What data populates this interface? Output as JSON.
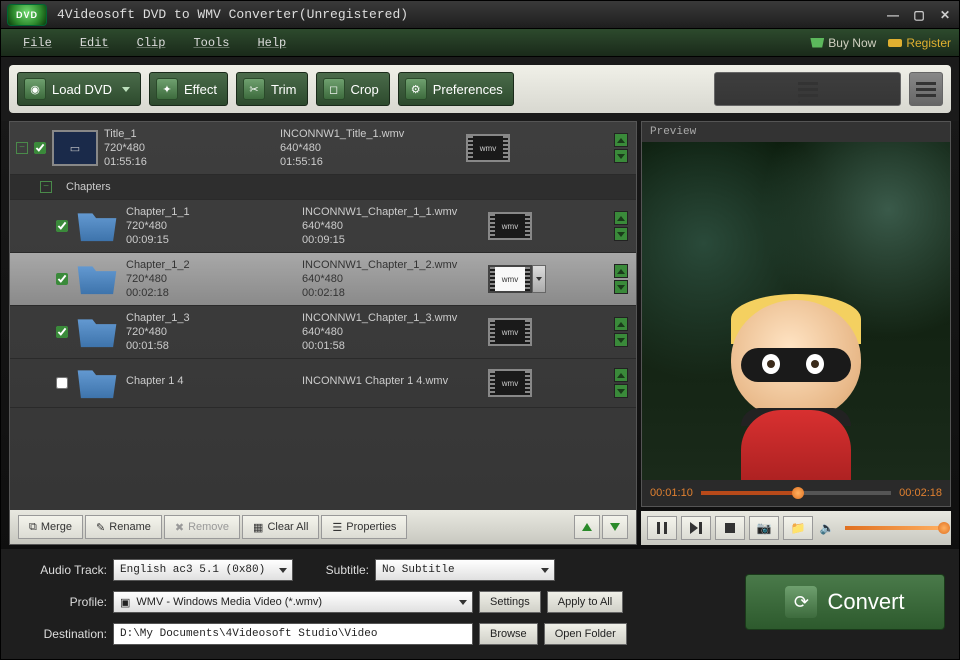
{
  "title": "4Videosoft DVD to WMV Converter(Unregistered)",
  "logo_text": "DVD",
  "menubar": {
    "file": "File",
    "edit": "Edit",
    "clip": "Clip",
    "tools": "Tools",
    "help": "Help",
    "buy": "Buy Now",
    "register": "Register"
  },
  "toolbar": {
    "load": "Load DVD",
    "effect": "Effect",
    "trim": "Trim",
    "crop": "Crop",
    "prefs": "Preferences"
  },
  "group_label": "Chapters",
  "items": [
    {
      "checked": true,
      "expandable": true,
      "kind": "title",
      "name": "Title_1",
      "res": "720*480",
      "dur": "01:55:16",
      "out": "INCONNW1_Title_1.wmv",
      "ores": "640*480",
      "odur": "01:55:16",
      "fmt": "wmv"
    },
    {
      "checked": true,
      "kind": "chapter",
      "name": "Chapter_1_1",
      "res": "720*480",
      "dur": "00:09:15",
      "out": "INCONNW1_Chapter_1_1.wmv",
      "ores": "640*480",
      "odur": "00:09:15",
      "fmt": "wmv"
    },
    {
      "checked": true,
      "kind": "chapter",
      "selected": true,
      "name": "Chapter_1_2",
      "res": "720*480",
      "dur": "00:02:18",
      "out": "INCONNW1_Chapter_1_2.wmv",
      "ores": "640*480",
      "odur": "00:02:18",
      "fmt": "wmv"
    },
    {
      "checked": true,
      "kind": "chapter",
      "name": "Chapter_1_3",
      "res": "720*480",
      "dur": "00:01:58",
      "out": "INCONNW1_Chapter_1_3.wmv",
      "ores": "640*480",
      "odur": "00:01:58",
      "fmt": "wmv"
    },
    {
      "checked": false,
      "kind": "chapter",
      "partial": true,
      "name": "Chapter 1 4",
      "res": "",
      "dur": "",
      "out": "INCONNW1 Chapter 1 4.wmv",
      "ores": "",
      "odur": "",
      "fmt": "wmv"
    }
  ],
  "ops": {
    "merge": "Merge",
    "rename": "Rename",
    "remove": "Remove",
    "clear": "Clear All",
    "props": "Properties"
  },
  "preview": {
    "label": "Preview",
    "cur": "00:01:10",
    "total": "00:02:18",
    "progress_pct": 51
  },
  "audio": {
    "label": "Audio Track:",
    "value": "English ac3 5.1 (0x80)"
  },
  "subtitle": {
    "label": "Subtitle:",
    "value": "No Subtitle"
  },
  "profile": {
    "label": "Profile:",
    "value": "WMV - Windows Media Video (*.wmv)",
    "settings": "Settings",
    "apply": "Apply to All"
  },
  "dest": {
    "label": "Destination:",
    "value": "D:\\My Documents\\4Videosoft Studio\\Video",
    "browse": "Browse",
    "open": "Open Folder"
  },
  "convert": "Convert"
}
